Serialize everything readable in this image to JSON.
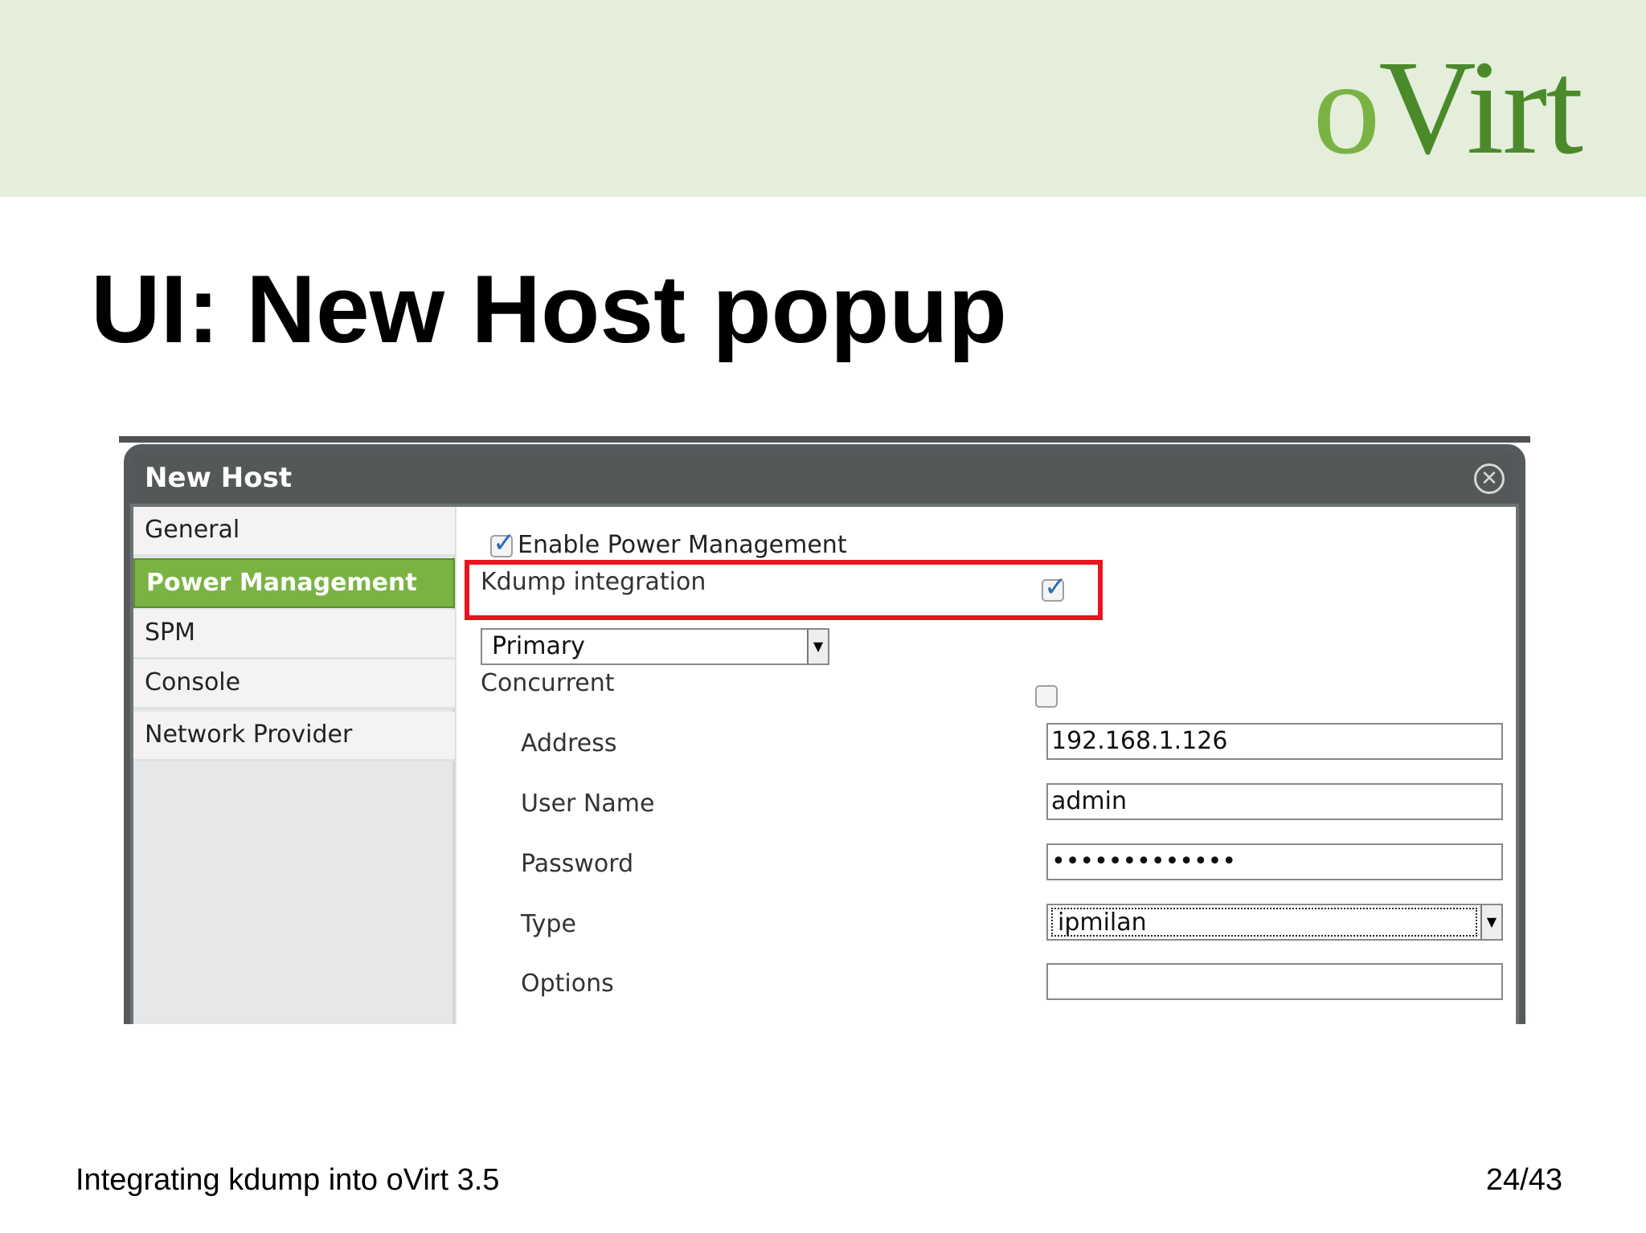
{
  "header": {
    "logo_first": "o",
    "logo_rest": "Virt"
  },
  "slide": {
    "title": "UI: New Host popup",
    "footer_text": "Integrating kdump into oVirt 3.5",
    "page_number": "24/43"
  },
  "dialog": {
    "title": "New Host",
    "close_icon": "close-circle-icon",
    "sidebar": [
      {
        "label": "General",
        "active": false
      },
      {
        "label": "Power Management",
        "active": true
      },
      {
        "label": "SPM",
        "active": false
      },
      {
        "label": "Console",
        "active": false
      },
      {
        "label": "Network Provider",
        "active": false
      }
    ],
    "form": {
      "enable_pm_label": "Enable Power Management",
      "enable_pm_checked": true,
      "kdump_label": "Kdump integration",
      "kdump_checked": true,
      "agent_select_value": "Primary",
      "concurrent_label": "Concurrent",
      "concurrent_checked": false,
      "address_label": "Address",
      "address_value": "192.168.1.126",
      "username_label": "User Name",
      "username_value": "admin",
      "password_label": "Password",
      "password_value": "•••••••••••••",
      "type_label": "Type",
      "type_value": "ipmilan",
      "options_label": "Options",
      "options_value": ""
    }
  },
  "colors": {
    "banner": "#e4eedb",
    "logo_green": "#7ab343",
    "active_tab": "#7ab343",
    "highlight_red": "#e8141e",
    "dialog_header": "#545859"
  }
}
